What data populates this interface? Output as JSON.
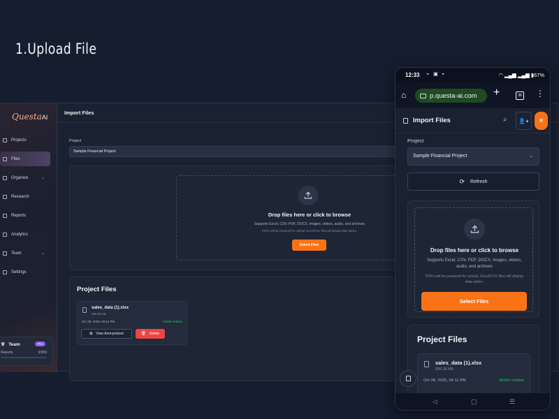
{
  "step_title": "1.Upload File",
  "desktop": {
    "logo_script": "Questa",
    "logo_suffix": "AI",
    "page_title": "Import Files",
    "sidebar": {
      "items": [
        {
          "label": "Projects",
          "icon": "folder-icon"
        },
        {
          "label": "Files",
          "icon": "file-icon",
          "active": true
        },
        {
          "label": "Organize",
          "icon": "organize-icon",
          "has_chevron": true
        },
        {
          "label": "Research",
          "icon": "research-icon"
        },
        {
          "label": "Reports",
          "icon": "report-icon"
        },
        {
          "label": "Analytics",
          "icon": "analytics-icon"
        },
        {
          "label": "Team",
          "icon": "team-icon",
          "has_chevron": true
        },
        {
          "label": "Settings",
          "icon": "gear-icon"
        }
      ],
      "team_box": {
        "title": "Team",
        "badge": "Pro",
        "reports_label": "Reports",
        "reports_count": "3/999"
      }
    },
    "project": {
      "label": "Project",
      "selected": "Sample Financial Project"
    },
    "dropzone": {
      "title": "Drop files here or click to browse",
      "subtitle": "Supports Excel, CSV, PDF, DOCX, images, videos, audio, and archives",
      "note": "PDFs will be prepared for upload. Excel/CSV files will display data tables.",
      "button": "Select Files"
    },
    "project_files": {
      "title": "Project Files",
      "files": [
        {
          "name": "sales_data (1).xlsx",
          "size": "599.36 KB",
          "date": "Oct 28, 2025, 06:11 PM",
          "entities": "45000 entities",
          "anon_button": "View Anonymized",
          "delete_button": "Delete"
        }
      ]
    }
  },
  "phone": {
    "status": {
      "time": "12:33",
      "battery": "67%"
    },
    "browser": {
      "url": "p.questa-ai.com",
      "tab_count": "36"
    },
    "header": {
      "title": "Import Files",
      "avatar": "R"
    },
    "project": {
      "label": "Project",
      "selected": "Sample Financial Project"
    },
    "refresh": "Refresh",
    "dropzone": {
      "title": "Drop files here or click to browse",
      "subtitle": "Supports Excel, CSV, PDF, DOCX, images, videos, audio, and archives",
      "note": "PDFs will be prepared for upload. Excel/CSV files will display data tables.",
      "button": "Select Files"
    },
    "project_files": {
      "title": "Project Files",
      "file": {
        "name": "sales_data (1).xlsx",
        "size": "599.36 KB",
        "date": "Oct 28, 2025, 06:11 PM",
        "entities": "45000 entities"
      }
    },
    "nav": {
      "back": "◁",
      "home": "▢",
      "recents": "☰"
    }
  },
  "colors": {
    "accent": "#f97316",
    "danger": "#ef4444",
    "success": "#22c55e",
    "pro_badge": "#8b5cf6"
  }
}
